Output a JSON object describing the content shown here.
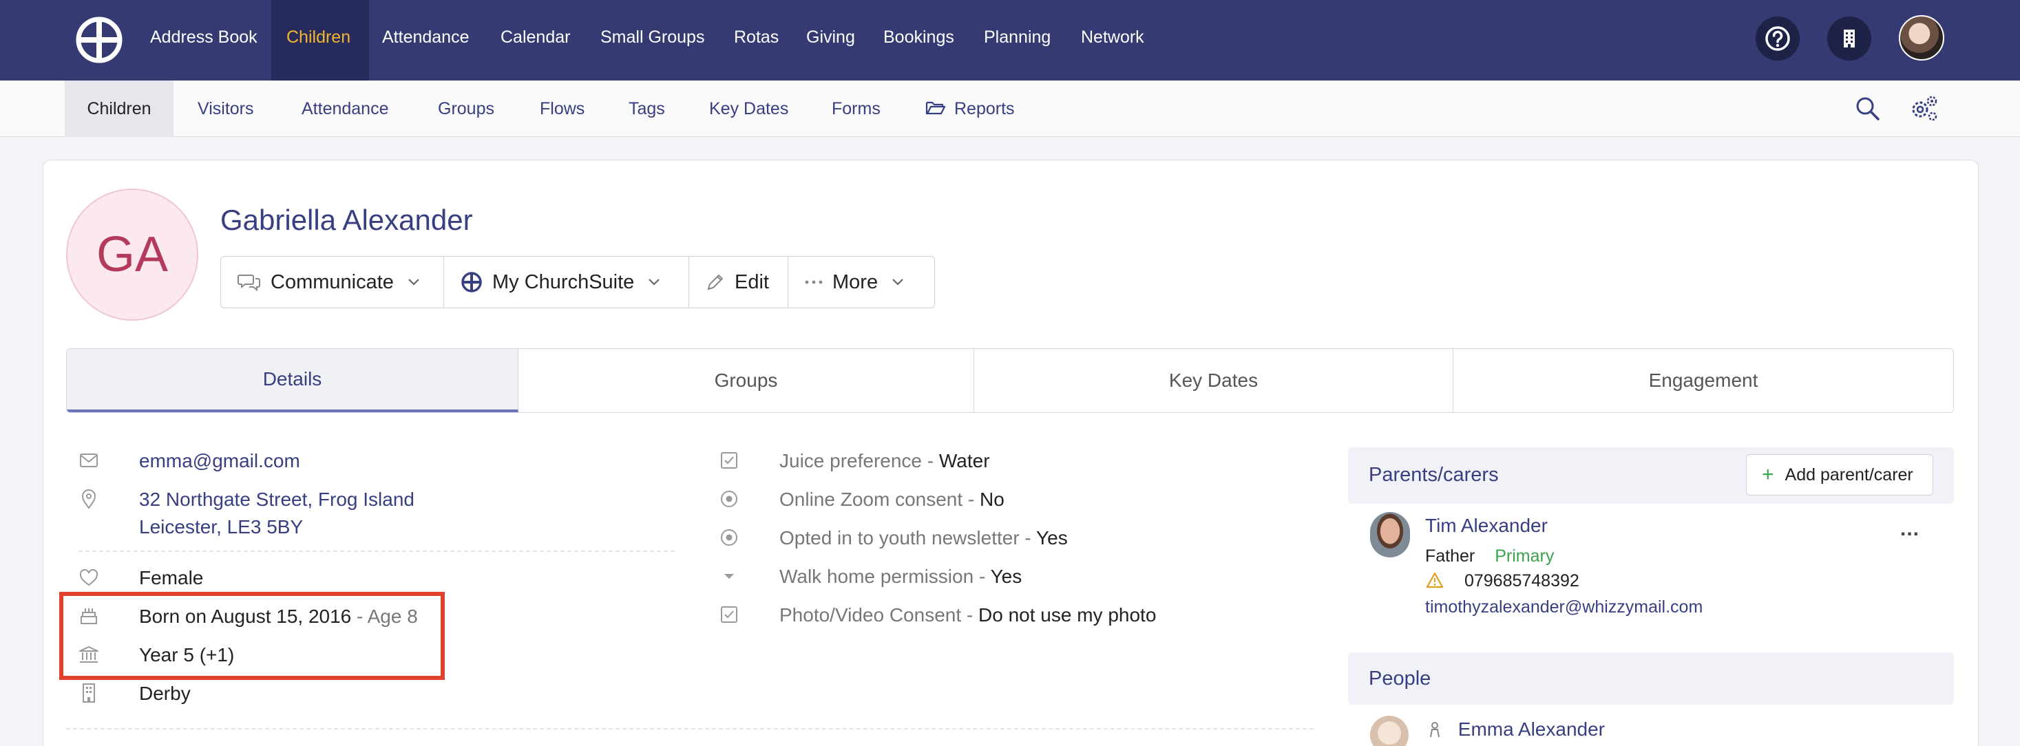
{
  "topnav": {
    "items": [
      "Address Book",
      "Children",
      "Attendance",
      "Calendar",
      "Small Groups",
      "Rotas",
      "Giving",
      "Bookings",
      "Planning",
      "Network"
    ],
    "active_index": 1
  },
  "subnav": {
    "items": [
      "Children",
      "Visitors",
      "Attendance",
      "Groups",
      "Flows",
      "Tags",
      "Key Dates",
      "Forms",
      "Reports"
    ],
    "active_index": 0
  },
  "profile": {
    "initials": "GA",
    "name": "Gabriella Alexander"
  },
  "actions": {
    "communicate": "Communicate",
    "my_churchsuite": "My ChurchSuite",
    "edit": "Edit",
    "more": "More"
  },
  "tabs": [
    "Details",
    "Groups",
    "Key Dates",
    "Engagement"
  ],
  "details": {
    "email": "emma@gmail.com",
    "address_line1": "32 Northgate Street, Frog Island",
    "address_line2": "Leicester, LE3 5BY",
    "sex": "Female",
    "born": "Born on August 15, 2016",
    "age": " - Age 8",
    "school_year": "Year 5 (+1)",
    "site": "Derby"
  },
  "custom_fields": [
    {
      "label": "Juice preference",
      "value": "Water"
    },
    {
      "label": "Online Zoom consent",
      "value": "No"
    },
    {
      "label": "Opted in to youth newsletter",
      "value": "Yes"
    },
    {
      "label": "Walk home permission",
      "value": "Yes"
    },
    {
      "label": "Photo/Video Consent",
      "value": "Do not use my photo"
    }
  ],
  "separator": " - ",
  "parents": {
    "title": "Parents/carers",
    "add_label": "Add parent/carer",
    "carer": {
      "name": "Tim Alexander",
      "relation": "Father",
      "badge": "Primary",
      "phone": "079685748392",
      "email": "timothyzalexander@whizzymail.com",
      "more": "..."
    }
  },
  "people": {
    "title": "People",
    "first_name": "Emma Alexander"
  },
  "colors": {
    "nav_bg": "#353b72",
    "nav_active_text": "#f2b531",
    "link": "#373f82",
    "highlight": "#e04230",
    "primary_badge": "#3aa34b"
  }
}
